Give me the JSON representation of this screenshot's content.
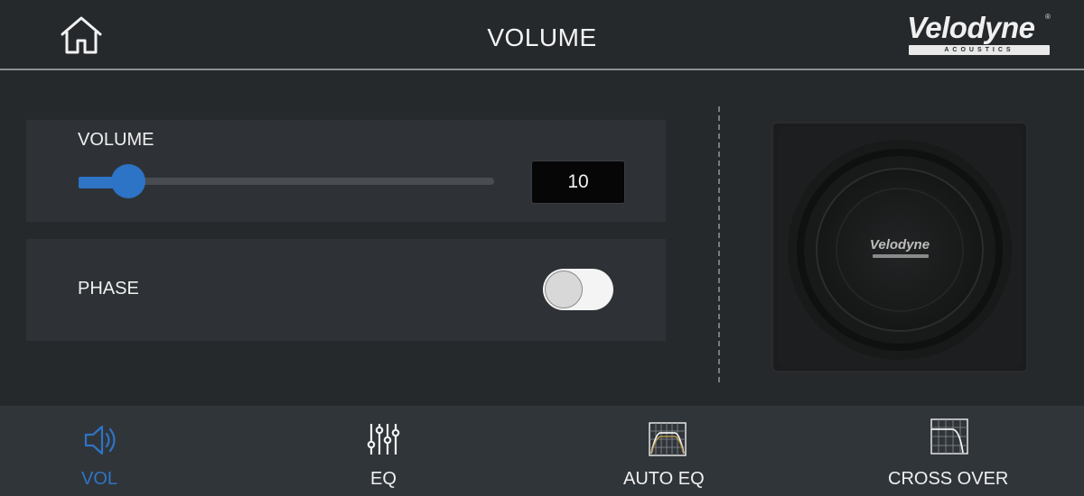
{
  "header": {
    "title": "VOLUME",
    "brand": {
      "name": "Velodyne",
      "registered": "®",
      "sub": "ACOUSTICS"
    }
  },
  "volume": {
    "label": "VOLUME",
    "value": "10",
    "level_fraction": 0.12
  },
  "phase": {
    "label": "PHASE",
    "enabled": false
  },
  "speaker": {
    "logo": "Velodyne"
  },
  "nav": {
    "items": [
      {
        "label": "VOL",
        "icon": "speaker-icon",
        "active": true
      },
      {
        "label": "EQ",
        "icon": "equalizer-sliders-icon",
        "active": false
      },
      {
        "label": "AUTO EQ",
        "icon": "auto-eq-graph-icon",
        "active": false
      },
      {
        "label": "CROSS OVER",
        "icon": "crossover-graph-icon",
        "active": false
      }
    ]
  },
  "colors": {
    "background": "#26292c",
    "panel": "#2e3236",
    "accent": "#2f74c5",
    "nav_background": "#30353a"
  }
}
